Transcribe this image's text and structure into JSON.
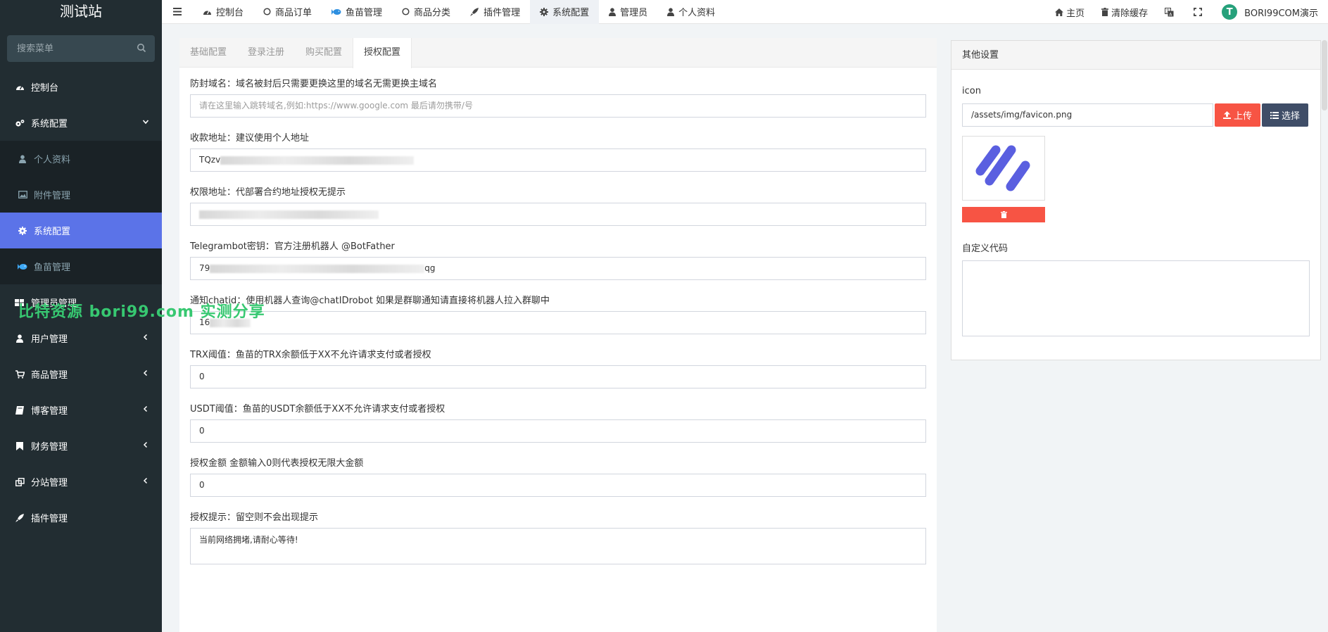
{
  "sidebar": {
    "logo": "测试站",
    "search_placeholder": "搜索菜单",
    "items": [
      {
        "label": "控制台",
        "icon": "dashboard-icon"
      },
      {
        "label": "系统配置",
        "icon": "gears-icon"
      },
      {
        "label": "个人资料",
        "icon": "user-icon"
      },
      {
        "label": "附件管理",
        "icon": "image-icon"
      },
      {
        "label": "系统配置",
        "icon": "gear-icon"
      },
      {
        "label": "鱼苗管理",
        "icon": "fish-icon"
      },
      {
        "label": "管理员管理",
        "icon": "users-icon"
      },
      {
        "label": "用户管理",
        "icon": "user-icon"
      },
      {
        "label": "商品管理",
        "icon": "cart-icon"
      },
      {
        "label": "博客管理",
        "icon": "book-icon"
      },
      {
        "label": "财务管理",
        "icon": "bookmark-icon"
      },
      {
        "label": "分站管理",
        "icon": "clone-icon"
      },
      {
        "label": "插件管理",
        "icon": "rocket-icon"
      }
    ],
    "watermark": "比特资源 bori99.com 实测分享"
  },
  "topbar": {
    "nav": [
      {
        "label": "控制台",
        "icon": "dashboard-icon"
      },
      {
        "label": "商品订单",
        "icon": "circle-icon"
      },
      {
        "label": "鱼苗管理",
        "icon": "fish-icon"
      },
      {
        "label": "商品分类",
        "icon": "circle-icon"
      },
      {
        "label": "插件管理",
        "icon": "rocket-icon"
      },
      {
        "label": "系统配置",
        "icon": "gear-icon"
      },
      {
        "label": "管理员",
        "icon": "user-icon"
      },
      {
        "label": "个人资料",
        "icon": "user-icon"
      }
    ],
    "right": {
      "home": "主页",
      "clear_cache": "清除缓存",
      "username": "BORI99COM演示"
    }
  },
  "tabs": [
    "基础配置",
    "登录注册",
    "购买配置",
    "授权配置"
  ],
  "fields": [
    {
      "label": "防封域名：域名被封后只需要更换这里的域名无需更换主域名",
      "value": "",
      "placeholder": "请在这里输入跳转域名,例如:https://www.google.com 最后请勿携带/号"
    },
    {
      "label": "收款地址：建议使用个人地址",
      "value": "TQzv"
    },
    {
      "label": "权限地址：代部署合约地址授权无提示",
      "value": ""
    },
    {
      "label": "Telegrambot密钥：官方注册机器人 @BotFather",
      "value": "79",
      "value_tail": "qg"
    },
    {
      "label": "通知chatid：使用机器人查询@chatIDrobot 如果是群聊通知请直接将机器人拉入群聊中",
      "value": "16"
    },
    {
      "label": "TRX阈值：鱼苗的TRX余额低于XX不允许请求支付或者授权",
      "value": "0"
    },
    {
      "label": "USDT阈值：鱼苗的USDT余额低于XX不允许请求支付或者授权",
      "value": "0"
    },
    {
      "label": "授权金额 金额输入0则代表授权无限大金额",
      "value": "0"
    },
    {
      "label": "授权提示：留空则不会出现提示",
      "value": "当前网络拥堵,请耐心等待!"
    }
  ],
  "other": {
    "title": "其他设置",
    "icon_label": "icon",
    "icon_value": "/assets/img/favicon.png",
    "upload_label": "上传",
    "choose_label": "选择",
    "code_label": "自定义代码",
    "code_value": ""
  },
  "colors": {
    "sidebar_bg": "#222d32",
    "active_blue": "#5b73e8",
    "danger": "#f75444",
    "dark_btn": "#3f4d67",
    "watermark": "#37c871"
  }
}
